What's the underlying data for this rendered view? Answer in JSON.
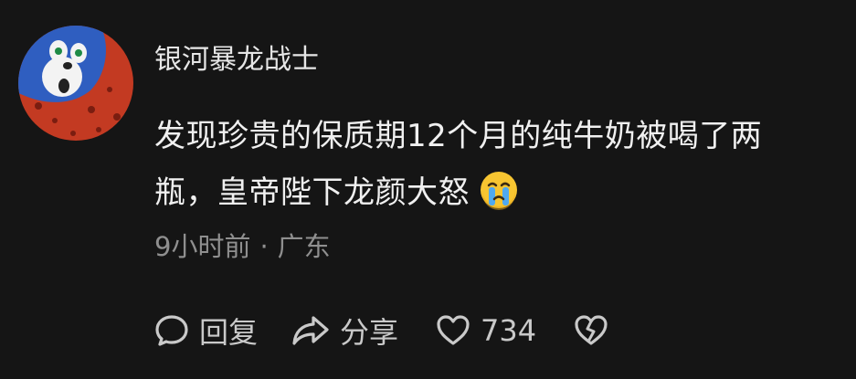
{
  "comment": {
    "username": "银河暴龙战士",
    "text_line1": "发现珍贵的保质期12个月的纯牛奶被喝了两",
    "text_line2": "瓶，皇帝陛下龙颜大怒",
    "emoji": "crying-face-icon",
    "time": "9小时前",
    "separator": "·",
    "location": "广东",
    "reply_label": "回复",
    "share_label": "分享",
    "like_count": "734"
  },
  "colors": {
    "background": "#151515",
    "text": "#f0f0f0",
    "meta": "#8f8f8f",
    "icon": "#c9c9c9"
  }
}
